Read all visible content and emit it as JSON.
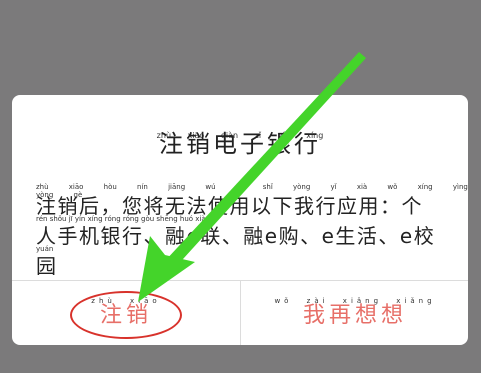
{
  "dialog": {
    "title": "注销电子银行",
    "title_pinyin": "zhù xiāo diàn zǐ yín xíng",
    "message_line1": "注销后，您将无法使用以下我行应用：个",
    "message_line2": "人手机银行、融e联、融e购、e生活、e校",
    "message_line3": "园",
    "message_pinyin1": "zhù xiāo hòu nín jiāng wú fǎ shǐ yòng yǐ xià wǒ xíng yìng yòng gè",
    "message_pinyin2": "rén shǒu jī yín xíng róng róng gòu shēng huó xiào",
    "message_pinyin3": "yuán",
    "confirm_label": "注销",
    "confirm_pinyin": "zhù xiāo",
    "cancel_label": "我再想想",
    "cancel_pinyin": "wǒ zài xiǎng xiǎng"
  },
  "colors": {
    "overlay": "#7b7a7b",
    "button_text": "#e76f68",
    "highlight_ring": "#d8322b",
    "annotation_arrow": "#44d42a"
  }
}
